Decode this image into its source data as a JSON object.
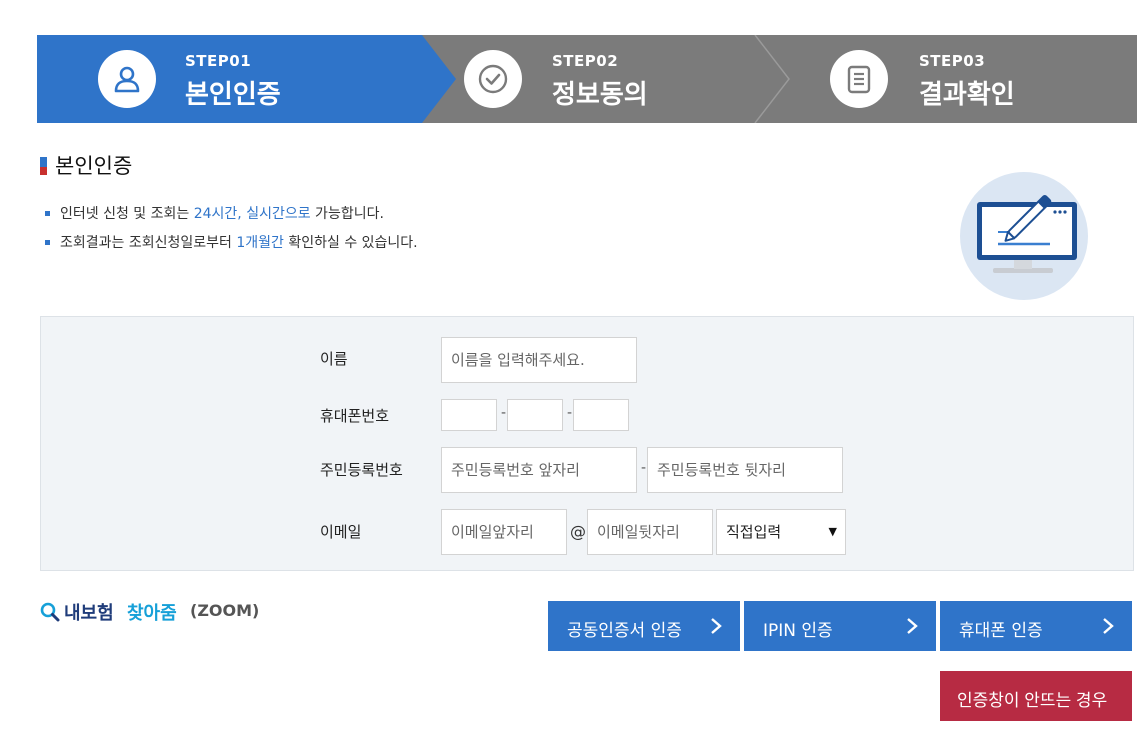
{
  "steps": [
    {
      "num": "STEP01",
      "title": "본인인증",
      "icon": "user-icon",
      "active": true
    },
    {
      "num": "STEP02",
      "title": "정보동의",
      "icon": "check-circle-icon",
      "active": false
    },
    {
      "num": "STEP03",
      "title": "결과확인",
      "icon": "document-icon",
      "active": false
    }
  ],
  "section": {
    "title": "본인인증"
  },
  "notices": [
    {
      "pre": "인터넷 신청 및 조회는 ",
      "hl": "24시간, 실시간으로",
      "post": " 가능합니다."
    },
    {
      "pre": "조회결과는 조회신청일로부터 ",
      "hl": "1개월간",
      "post": " 확인하실 수 있습니다."
    }
  ],
  "form": {
    "name_label": "이름",
    "name_placeholder": "이름을 입력해주세요.",
    "phone_label": "휴대폰번호",
    "phone_sep": "-",
    "rrn_label": "주민등록번호",
    "rrn_front_placeholder": "주민등록번호 앞자리",
    "rrn_back_placeholder": "주민등록번호 뒷자리",
    "rrn_sep": "-",
    "email_label": "이메일",
    "email_front_placeholder": "이메일앞자리",
    "email_at": "@",
    "email_back_placeholder": "이메일뒷자리",
    "email_domain_selected": "직접입력"
  },
  "logo": {
    "part1": "내보험",
    "part2": "찾아줌",
    "part3": "(ZOOM)"
  },
  "buttons": {
    "cert": "공동인증서 인증",
    "ipin": "IPIN 인증",
    "phone": "휴대폰 인증",
    "popup_help": "인증창이 안뜨는 경우"
  },
  "colors": {
    "primary": "#2f74c9",
    "step_inactive": "#7b7b7b",
    "danger": "#b72b43",
    "form_bg": "#f1f4f7"
  }
}
